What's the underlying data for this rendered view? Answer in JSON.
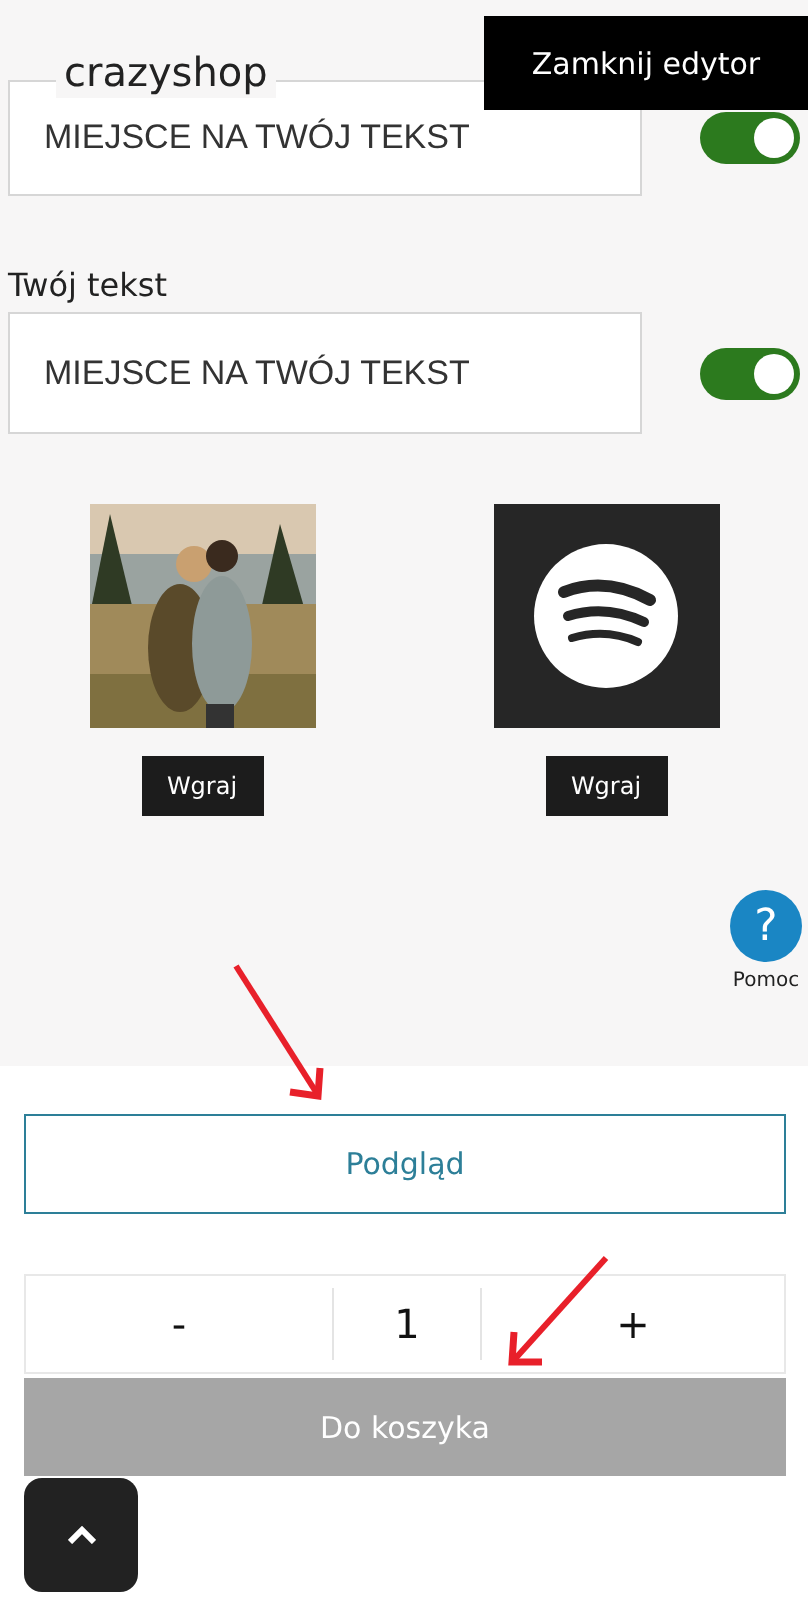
{
  "header": {
    "logo": "crazyshop",
    "close_button": "Zamknij edytor"
  },
  "text_fields": [
    {
      "value": "MIEJSCE NA TWÓJ TEKST",
      "on": true
    },
    {
      "label": "Twój tekst",
      "value": "MIEJSCE NA TWÓJ TEKST",
      "on": true
    }
  ],
  "uploads": [
    {
      "kind": "picture",
      "button": "Wgraj"
    },
    {
      "kind": "logo",
      "button": "Wgraj"
    }
  ],
  "help": {
    "icon_text": "?",
    "label": "Pomoc"
  },
  "preview_button": "Podgląd",
  "quantity": {
    "minus": "-",
    "value": "1",
    "plus": "+"
  },
  "cart_button": "Do koszyka"
}
